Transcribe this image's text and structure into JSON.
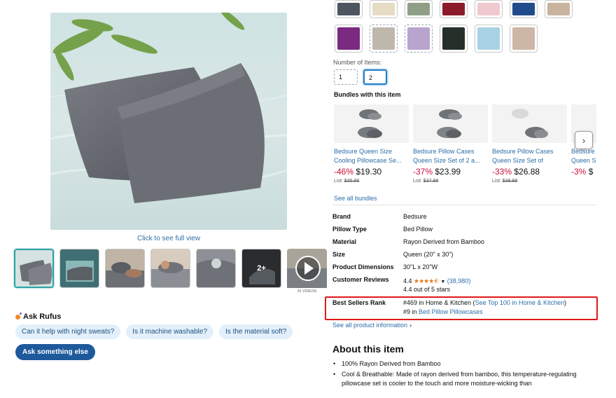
{
  "gallery": {
    "click_full": "Click to see full view",
    "more_count": "2+",
    "video_caption": "20 VIDEOS"
  },
  "rufus": {
    "title": "Ask Rufus",
    "chips": [
      "Can it help with night sweats?",
      "Is it machine washable?",
      "Is the material soft?"
    ],
    "ask_button": "Ask something else"
  },
  "swatches": {
    "row1": [
      "#4d5560",
      "#e6dcc3",
      "#8f9f86",
      "#8b1b2b",
      "#f0c9cf",
      "#214c8c",
      "#c9b39f"
    ],
    "row2": [
      "#7a2a80",
      "#bfb7ac",
      "#b9a3cf",
      "#25302a",
      "#a9d2e4",
      "#cdb6a6"
    ]
  },
  "quantity": {
    "label": "Number of Items:",
    "options": [
      "1",
      "2"
    ],
    "selected": "2"
  },
  "bundles": {
    "title": "Bundles with this item",
    "items": [
      {
        "name1": "Bedsure Queen Size",
        "name2": "Cooling Pillowcase Se...",
        "discount": "-46%",
        "price": "$19.30",
        "list_label": "List:",
        "list_price": "$35.98"
      },
      {
        "name1": "Bedsure Pillow Cases",
        "name2": "Queen Size Set of 2 a...",
        "discount": "-37%",
        "price": "$23.99",
        "list_label": "List:",
        "list_price": "$37.98"
      },
      {
        "name1": "Bedsure Pillow Cases",
        "name2": "Queen Size Set of",
        "discount": "-33%",
        "price": "$26.88",
        "list_label": "List:",
        "list_price": "$39.98"
      },
      {
        "name1": "Bedsure",
        "name2": "Queen S",
        "discount": "-3%",
        "price": "$",
        "list_label": "",
        "list_price": ""
      }
    ],
    "see_all": "See all bundles",
    "next_icon": "›"
  },
  "specs": {
    "brand_k": "Brand",
    "brand_v": "Bedsure",
    "type_k": "Pillow Type",
    "type_v": "Bed Pillow",
    "material_k": "Material",
    "material_v": "Rayon Derived from Bamboo",
    "size_k": "Size",
    "size_v": "Queen (20\" x 30\")",
    "dims_k": "Product Dimensions",
    "dims_v": "30\"L x 20\"W",
    "reviews_k": "Customer Reviews",
    "rating": "4.4",
    "stars": "★★★★⯪",
    "review_count": "(38,980)",
    "rating_text": "4.4 out of 5 stars",
    "rank_k": "Best Sellers Rank",
    "rank1_prefix": "#469 in Home & Kitchen (",
    "rank1_link": "See Top 100 in Home & Kitchen",
    "rank1_suffix": ")",
    "rank2_prefix": "#9 in ",
    "rank2_link": "Bed Pillow Pillowcases"
  },
  "see_all_info": "See all product information",
  "about": {
    "title": "About this item",
    "bullets": [
      "100% Rayon Derived from Bamboo",
      "Cool & Breathable: Made of rayon derived from bamboo, this temperature-regulating pillowcase set is cooler to the touch and more moisture-wicking than"
    ]
  }
}
